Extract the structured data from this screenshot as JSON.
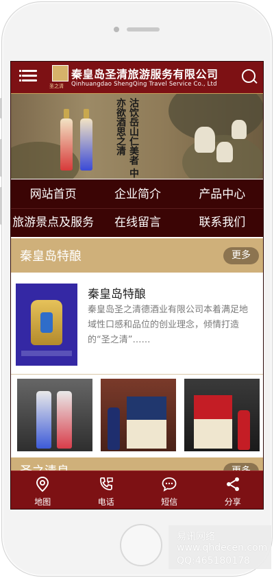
{
  "header": {
    "company_name": "秦皇岛圣清旅游服务有限公司",
    "company_name_en": "Qinhuangdao ShengQing Travel Service Co., Ltd",
    "logo_sub": "圣之清"
  },
  "banner": {
    "poem": "沽饮岳山仁美者 中亦欲酒思之清"
  },
  "nav": {
    "items": [
      {
        "label": "网站首页"
      },
      {
        "label": "企业简介"
      },
      {
        "label": "产品中心"
      },
      {
        "label": "旅游景点及服务"
      },
      {
        "label": "在线留言"
      },
      {
        "label": "联系我们"
      }
    ]
  },
  "section1": {
    "title": "秦皇岛特酿",
    "more_label": "更多"
  },
  "product": {
    "title": "秦皇岛特酿",
    "description": "秦皇岛圣之清德酒业有限公司本着满足地域性口感和品位的创业理念，倾情打造的“圣之清”……"
  },
  "section2": {
    "title": "圣之清良",
    "more_label": "更多"
  },
  "footer": {
    "items": [
      {
        "label": "地图",
        "icon": "map-pin-icon"
      },
      {
        "label": "电话",
        "icon": "phone-icon"
      },
      {
        "label": "短信",
        "icon": "message-icon"
      },
      {
        "label": "分享",
        "icon": "share-icon"
      }
    ]
  },
  "watermark": {
    "line1": "易讯网络",
    "line2": "www.qhdecen.com",
    "line3": "QQ:465180178"
  },
  "colors": {
    "brand_red": "#7d1114",
    "nav_dark": "#3b0505",
    "gold": "#cfb07a"
  }
}
